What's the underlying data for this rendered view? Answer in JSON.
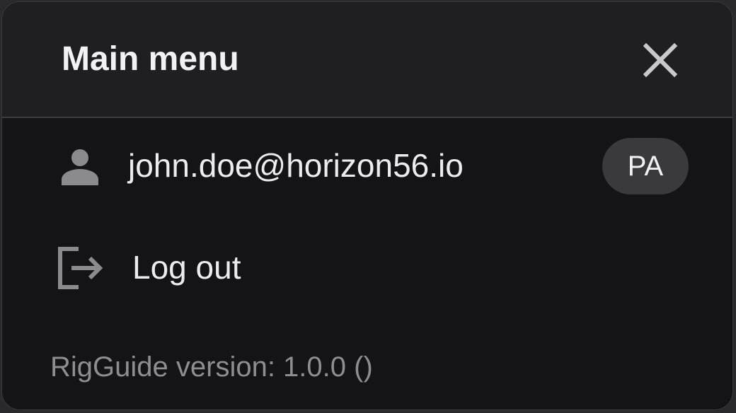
{
  "menu": {
    "title": "Main menu",
    "close_icon": "close-icon"
  },
  "user": {
    "icon": "person-icon",
    "email": "john.doe@horizon56.io",
    "role_badge": "PA"
  },
  "logout": {
    "icon": "logout-icon",
    "label": "Log out"
  },
  "footer": {
    "version_text": "RigGuide version: 1.0.0 ()"
  },
  "colors": {
    "panel_bg": "#141416",
    "header_bg": "#1f1f22",
    "badge_bg": "#3a3a3d",
    "icon_gray": "#8a8a8f",
    "muted_text": "#8d8d92"
  }
}
